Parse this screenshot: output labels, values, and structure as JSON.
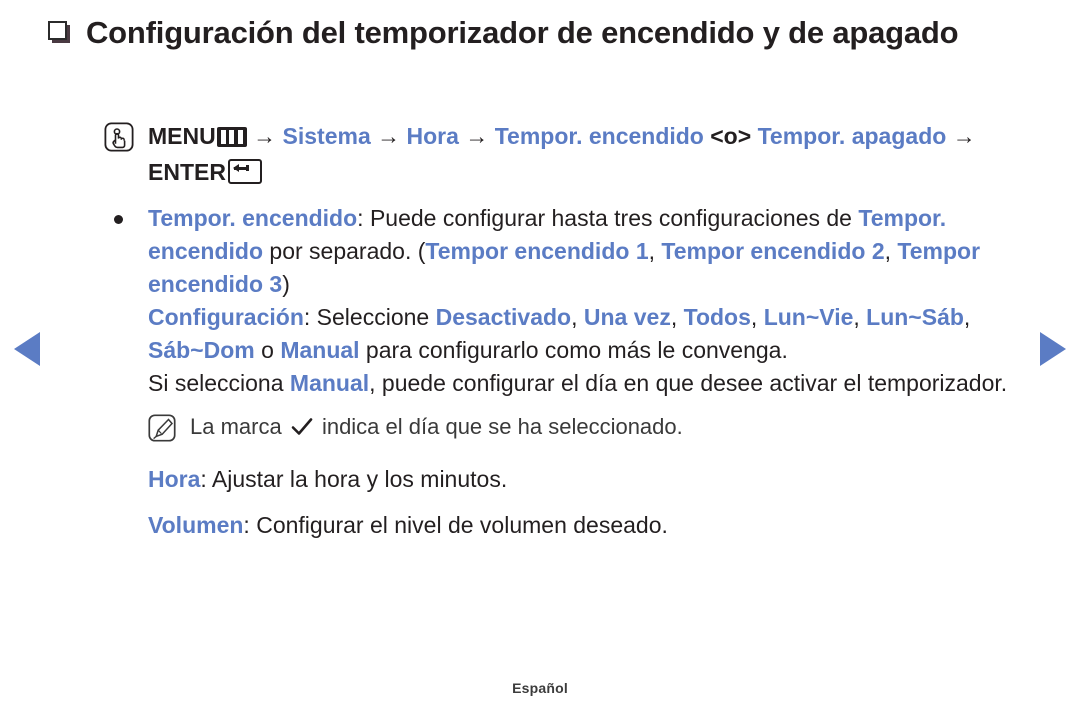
{
  "page": {
    "language_footer": "Español",
    "accent_blue": "#5b7cc4",
    "text_black": "#231f20"
  },
  "nav": {
    "prev_label": "Página anterior",
    "next_label": "Página siguiente"
  },
  "title": {
    "bullet_icon": "square-bullet-icon",
    "text": "Configuración del temporizador de encendido y de apagado"
  },
  "menu_path": {
    "icon": "hand-press-icon",
    "menu_label": "MENU",
    "menu_glyph_icon": "menu-bars-icon",
    "arrow": "→",
    "step1": "Sistema",
    "step2": "Hora",
    "step3": "Tempor. encendido",
    "separator": "<o>",
    "step4_line1": "Tempor.",
    "step4_line2": "apagado",
    "enter_label": "ENTER",
    "enter_glyph_icon": "enter-key-icon"
  },
  "bullet": {
    "dot_icon": "bullet-dot-icon",
    "term": "Tempor. encendido",
    "colon": ": ",
    "text_a": "Puede configurar hasta tres configuraciones de ",
    "term2": "Tempor. encendido",
    "text_b": " por separado. (",
    "opt1": "Tempor encendido 1",
    "sep1": ", ",
    "opt2": "Tempor encendido 2",
    "sep2": ", ",
    "opt3": "Tempor encendido 3",
    "close": ")"
  },
  "config": {
    "term": "Configuración",
    "colon": ": ",
    "lead": "Seleccione ",
    "options": [
      "Desactivado",
      "Una vez",
      "Todos",
      "Lun~Vie",
      "Lun~Sáb",
      "Sáb~Dom"
    ],
    "or_word": " o ",
    "manual": "Manual",
    "tail": " para configurarlo como más le convenga.",
    "line3_a": "Si selecciona ",
    "line3_manual": "Manual",
    "line3_b": ", puede configurar el día en que desee activar el temporizador."
  },
  "note": {
    "icon": "note-pencil-icon",
    "text_a": "La marca ",
    "check_icon": "checkmark-icon",
    "text_b": " indica el día que se ha seleccionado."
  },
  "hora": {
    "term": "Hora",
    "colon": ": ",
    "text": "Ajustar la hora y los minutos."
  },
  "volumen": {
    "term": "Volumen",
    "colon": ": ",
    "text": "Configurar el nivel de volumen deseado."
  }
}
